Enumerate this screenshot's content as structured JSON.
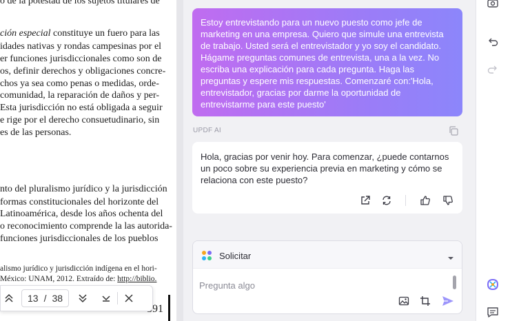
{
  "document": {
    "paragraph1": [
      "o de la potestad de los sujetos titulares de",
      "",
      "ción especial constituye un fuero para las",
      "idades nativas y rondas campesinas por el",
      "er funciones jurisdiccionales como son de",
      "os, definir derechos y obligaciones concre-",
      "chos ya sea como penas o medidas,  orde-",
      " comunidad, la reparación de daños y per-",
      "Esta jurisdicción no está obligada a seguir",
      "e rige por el derecho consuetudinario, sin",
      "es de las personas."
    ],
    "paragraph1_italic": "ción especial",
    "paragraph1_rest": " constituye un fuero para las",
    "paragraph2": [
      "nto del pluralismo jurídico y la jurisdicción",
      "formas constitucionales del horizonte del",
      "Latinoamérica, desde los años ochenta del",
      "o reconocimiento comprende la las autorida-",
      " funciones jurisdiccionales de los pueblos"
    ],
    "footnote": {
      "line1": "alismo jurídico y jurisdicción indígena en el hori-",
      "line2_text": " México: UNAM, 2012. Extraído de: ",
      "line2_link": "http://biblio."
    },
    "page_number_printed": "591"
  },
  "pager": {
    "current_page": "13",
    "separator": "/",
    "total_pages": "38"
  },
  "chat": {
    "user_message_lines": [
      "Estoy  entrevistando para un nuevo puesto como jefe de",
      "marketing en una empresa. Quiero que simule una entrevista",
      "de trabajo. Usted será el entrevistador y yo soy el candidato.",
      "Hágame preguntas comunes de entrevista, una a la vez. No",
      "escriba una explicación para cada pregunta. Haga las",
      "preguntas y espere mis respuestas. Comenzaré con:'Hola,",
      "entrevistador, gracias por darme la oportunidad de",
      "entrevistarme para este puesto'"
    ],
    "assistant_label": "UPDF AI",
    "assistant_message_lines": [
      "Hola, gracias por venir hoy. Para comenzar, ¿puede contarnos",
      "un poco sobre su experiencia previa en marketing y cómo se",
      "relaciona con este puesto?"
    ]
  },
  "composer": {
    "mode_label": "Solicitar",
    "placeholder": "Pregunta algo"
  },
  "icons": {
    "pager": [
      "chevron-up-icon",
      "chevron-double-down-icon",
      "chevron-down-icon",
      "close-icon"
    ],
    "message_actions": [
      "share-icon",
      "regenerate-icon",
      "thumbs-up-icon",
      "thumbs-down-icon"
    ],
    "composer": [
      "image-icon",
      "crop-icon",
      "send-icon"
    ],
    "rail": [
      "camera-icon",
      "undo-icon",
      "redo-icon",
      "updf-ai-logo-icon",
      "comment-icon"
    ]
  },
  "colors": {
    "user_bubble_start": "#c06cf0",
    "user_bubble_end": "#8c86fb",
    "send_icon": "#9d96fb",
    "app_background": "#f1f1f4"
  }
}
